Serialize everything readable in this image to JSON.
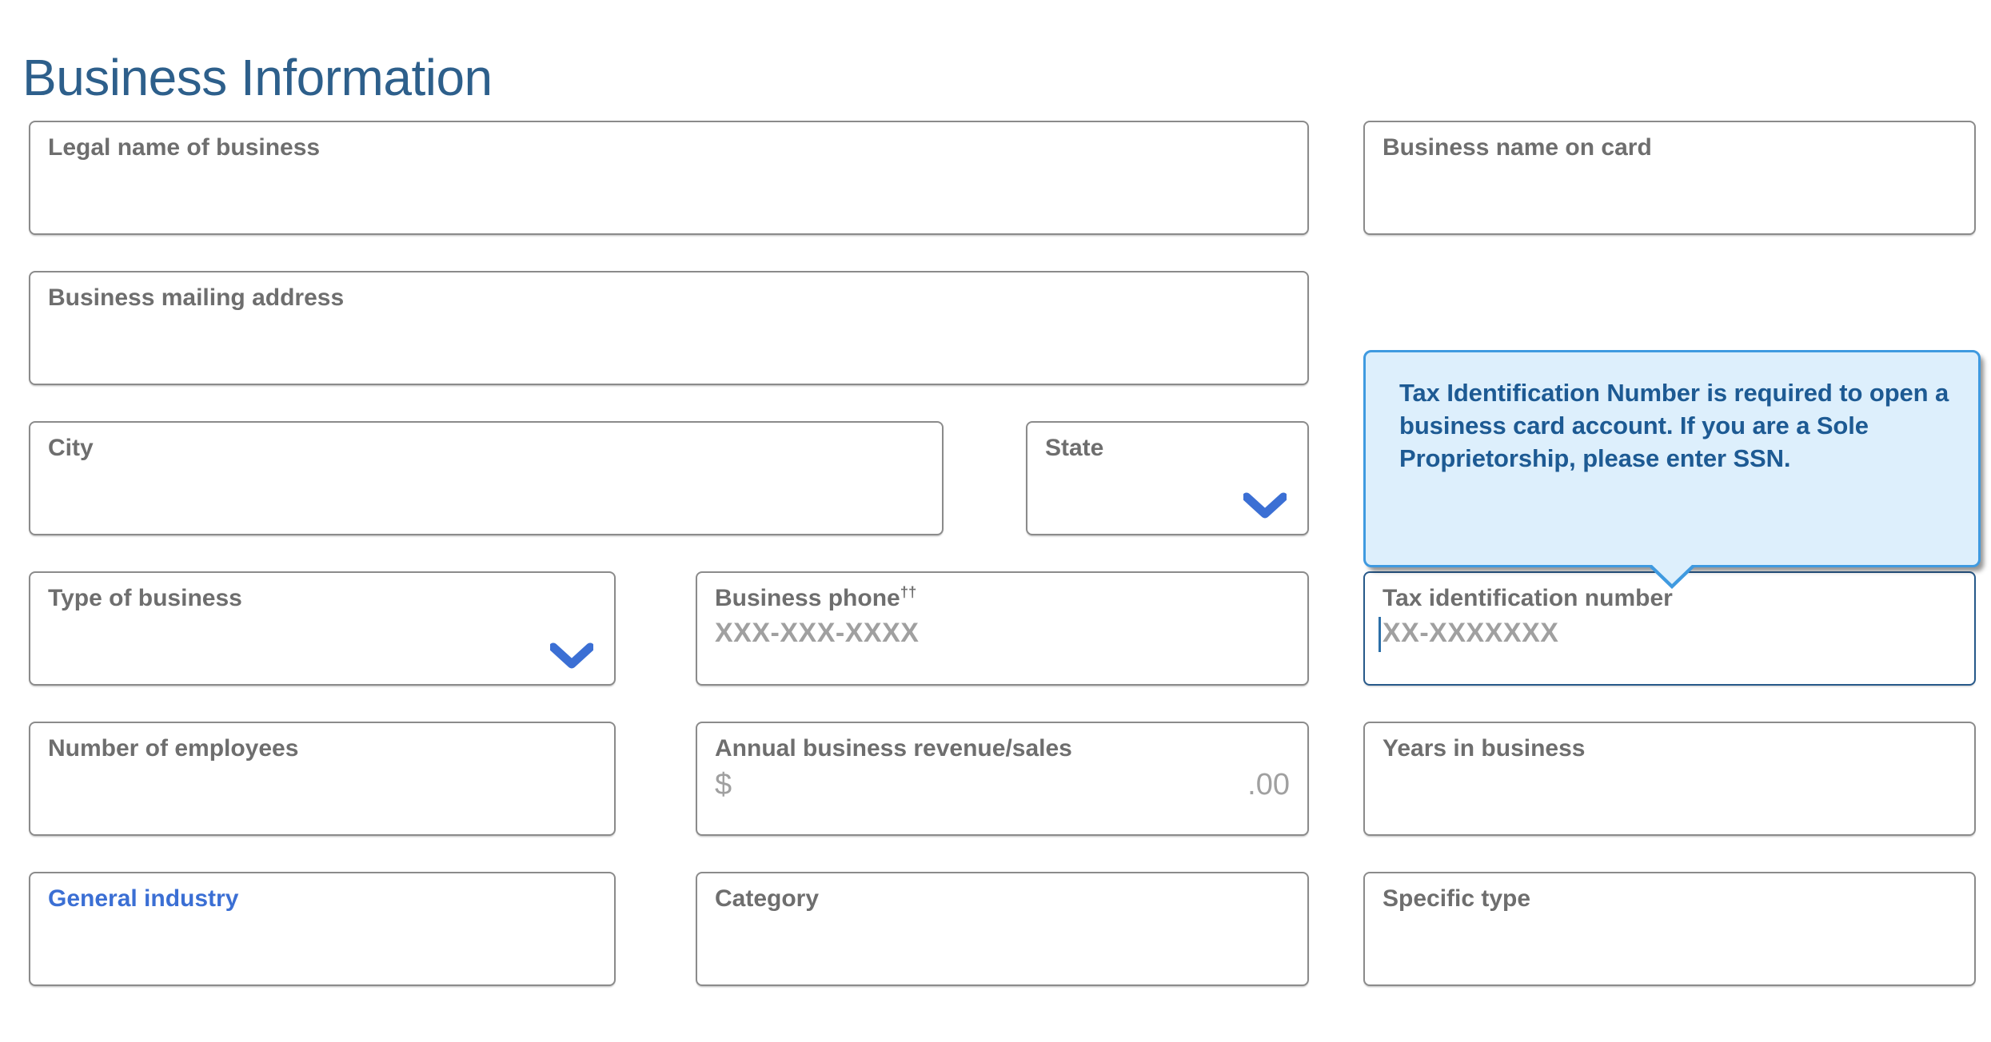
{
  "header": {
    "title": "Business Information",
    "title_color": "#2d5f8b"
  },
  "colors": {
    "label": "#6e6e6e",
    "accent_blue": "#3b6fd4",
    "chevron_blue": "#3b6fd4",
    "field_border": "#8b8b8b",
    "focus_border": "#27598a",
    "tooltip_bg": "#ddeffc",
    "tooltip_border": "#3f9ae0",
    "tooltip_text": "#1d5a93",
    "placeholder": "#a0a0a0"
  },
  "tooltip": {
    "text": "Tax Identification Number is required to open a business card account. If you are a Sole Proprietorship, please enter SSN.",
    "points_to": "tax-identification-number-field"
  },
  "fields": {
    "legal_name": {
      "label": "Legal name of business",
      "value": ""
    },
    "business_name_on_card": {
      "label": "Business name on card",
      "value": ""
    },
    "mailing_address": {
      "label": "Business mailing address",
      "value": ""
    },
    "city": {
      "label": "City",
      "value": ""
    },
    "state": {
      "label": "State",
      "value": "",
      "icon": "chevron-down-icon"
    },
    "type_of_business": {
      "label": "Type of business",
      "value": "",
      "icon": "chevron-down-icon"
    },
    "business_phone": {
      "label": "Business phone",
      "label_superscript": "††",
      "value": "",
      "placeholder": "XXX-XXX-XXXX"
    },
    "tax_id": {
      "label": "Tax identification number",
      "value": "",
      "placeholder": "XX-XXXXXXX",
      "focused": true
    },
    "number_of_employees": {
      "label": "Number of employees",
      "value": ""
    },
    "annual_revenue": {
      "label": "Annual business revenue/sales",
      "prefix": "$",
      "suffix": ".00",
      "value": ""
    },
    "years_in_business": {
      "label": "Years in business",
      "value": ""
    },
    "general_industry": {
      "label": "General industry",
      "value": "",
      "label_style": "accent"
    },
    "category": {
      "label": "Category",
      "value": ""
    },
    "specific_type": {
      "label": "Specific type",
      "value": ""
    }
  }
}
